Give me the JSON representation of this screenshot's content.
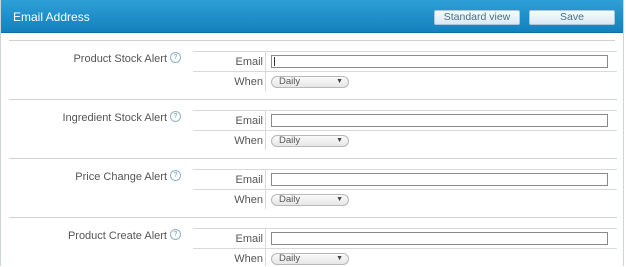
{
  "header": {
    "title": "Email Address",
    "standard_view_label": "Standard view",
    "save_label": "Save"
  },
  "alerts": [
    {
      "label": "Product Stock Alert",
      "email_label": "Email",
      "email_value": "",
      "when_label": "When",
      "when_value": "Daily"
    },
    {
      "label": "Ingredient Stock Alert",
      "email_label": "Email",
      "email_value": "",
      "when_label": "When",
      "when_value": "Daily"
    },
    {
      "label": "Price Change Alert",
      "email_label": "Email",
      "email_value": "",
      "when_label": "When",
      "when_value": "Daily"
    },
    {
      "label": "Product Create Alert",
      "email_label": "Email",
      "email_value": "",
      "when_label": "When",
      "when_value": "Daily"
    }
  ],
  "icons": {
    "help": "help-icon",
    "dropdown": "chevron-down-icon"
  }
}
